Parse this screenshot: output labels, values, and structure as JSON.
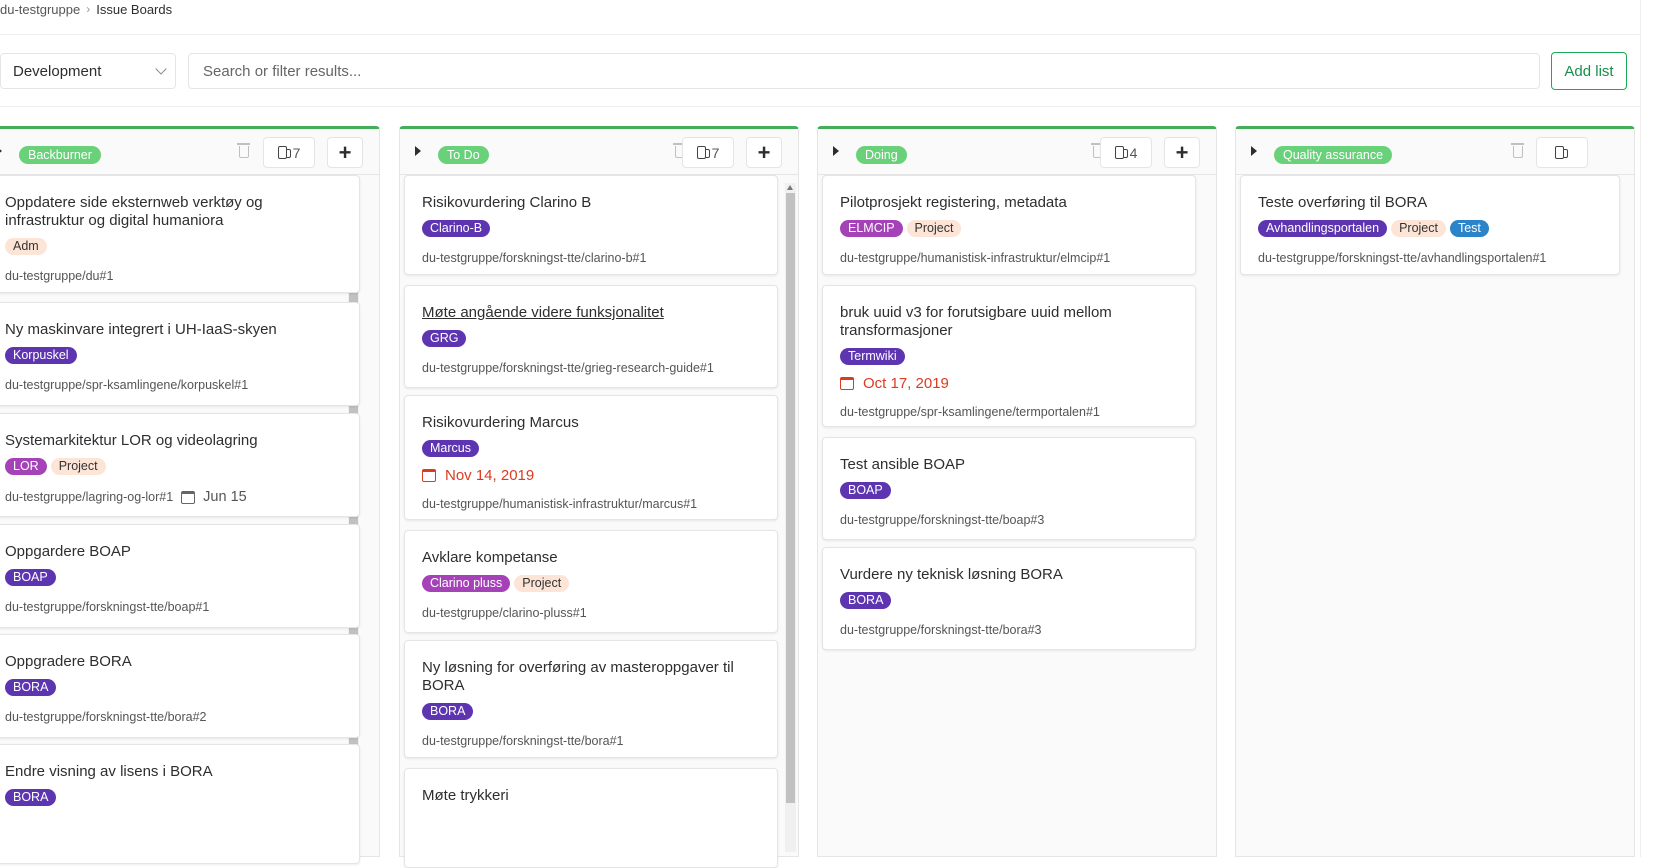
{
  "breadcrumb": {
    "group": "du-testgruppe",
    "page": "Issue Boards"
  },
  "filter": {
    "scope": "Development",
    "search_placeholder": "Search or filter results...",
    "add_list": "Add list"
  },
  "accent": "#44ad5a",
  "boards": [
    {
      "label": "Backburner",
      "count": "7",
      "cards": [
        {
          "title": "Oppdatere side eksternweb verktøy og infrastruktur og digital humaniora",
          "labels": [
            {
              "text": "Adm",
              "style": "peach"
            }
          ],
          "ref": "du-testgruppe/du#1"
        },
        {
          "title": "Ny maskinvare integrert i UH-IaaS-skyen",
          "labels": [
            {
              "text": "Korpuskel",
              "style": "purple"
            }
          ],
          "ref": "du-testgruppe/spr-ksamlingene/korpuskel#1"
        },
        {
          "title": "Systemarkitektur LOR og videolagring",
          "labels": [
            {
              "text": "LOR",
              "style": "violet"
            },
            {
              "text": "Project",
              "style": "peach"
            }
          ],
          "ref": "du-testgruppe/lagring-og-lor#1",
          "due": "Jun 15"
        },
        {
          "title": "Oppgardere BOAP",
          "labels": [
            {
              "text": "BOAP",
              "style": "purple"
            }
          ],
          "ref": "du-testgruppe/forskningst-tte/boap#1"
        },
        {
          "title": "Oppgradere BORA",
          "labels": [
            {
              "text": "BORA",
              "style": "purple"
            }
          ],
          "ref": "du-testgruppe/forskningst-tte/bora#2"
        },
        {
          "title": "Endre visning av lisens i BORA",
          "labels": [
            {
              "text": "BORA",
              "style": "purple"
            }
          ],
          "ref": ""
        }
      ]
    },
    {
      "label": "To Do",
      "count": "7",
      "cards": [
        {
          "title": "Risikovurdering Clarino B",
          "labels": [
            {
              "text": "Clarino-B",
              "style": "purple"
            }
          ],
          "ref": "du-testgruppe/forskningst-tte/clarino-b#1"
        },
        {
          "title": "Møte angående videre funksjonalitet",
          "labels": [
            {
              "text": "GRG",
              "style": "purple"
            }
          ],
          "ref": "du-testgruppe/forskningst-tte/grieg-research-guide#1"
        },
        {
          "title": "Risikovurdering Marcus",
          "labels": [
            {
              "text": "Marcus",
              "style": "purple"
            }
          ],
          "due": "Nov 14, 2019",
          "ref": "du-testgruppe/humanistisk-infrastruktur/marcus#1"
        },
        {
          "title": "Avklare kompetanse",
          "labels": [
            {
              "text": "Clarino pluss",
              "style": "violet"
            },
            {
              "text": "Project",
              "style": "peach"
            }
          ],
          "ref": "du-testgruppe/clarino-pluss#1"
        },
        {
          "title": "Ny løsning for overføring av masteroppgaver til BORA",
          "labels": [
            {
              "text": "BORA",
              "style": "purple"
            }
          ],
          "ref": "du-testgruppe/forskningst-tte/bora#1"
        },
        {
          "title": "Møte trykkeri",
          "labels": [],
          "ref": ""
        }
      ]
    },
    {
      "label": "Doing",
      "count": "4",
      "cards": [
        {
          "title": "Pilotprosjekt registering, metadata",
          "labels": [
            {
              "text": "ELMCIP",
              "style": "violet"
            },
            {
              "text": "Project",
              "style": "peach"
            }
          ],
          "ref": "du-testgruppe/humanistisk-infrastruktur/elmcip#1"
        },
        {
          "title": "bruk uuid v3 for forutsigbare uuid mellom transformasjoner",
          "labels": [
            {
              "text": "Termwiki",
              "style": "purple"
            }
          ],
          "due": "Oct 17, 2019",
          "ref": "du-testgruppe/spr-ksamlingene/termportalen#1"
        },
        {
          "title": "Test ansible BOAP",
          "labels": [
            {
              "text": "BOAP",
              "style": "purple"
            }
          ],
          "ref": "du-testgruppe/forskningst-tte/boap#3"
        },
        {
          "title": "Vurdere ny teknisk løsning BORA",
          "labels": [
            {
              "text": "BORA",
              "style": "purple"
            }
          ],
          "ref": "du-testgruppe/forskningst-tte/bora#3"
        }
      ]
    },
    {
      "label": "Quality assurance",
      "count": "",
      "cards": [
        {
          "title": "Teste overføring til BORA",
          "labels": [
            {
              "text": "Avhandlingsportalen",
              "style": "purple"
            },
            {
              "text": "Project",
              "style": "peach"
            },
            {
              "text": "Test",
              "style": "blue"
            }
          ],
          "ref": "du-testgruppe/forskningst-tte/avhandlingsportalen#1"
        }
      ]
    }
  ]
}
